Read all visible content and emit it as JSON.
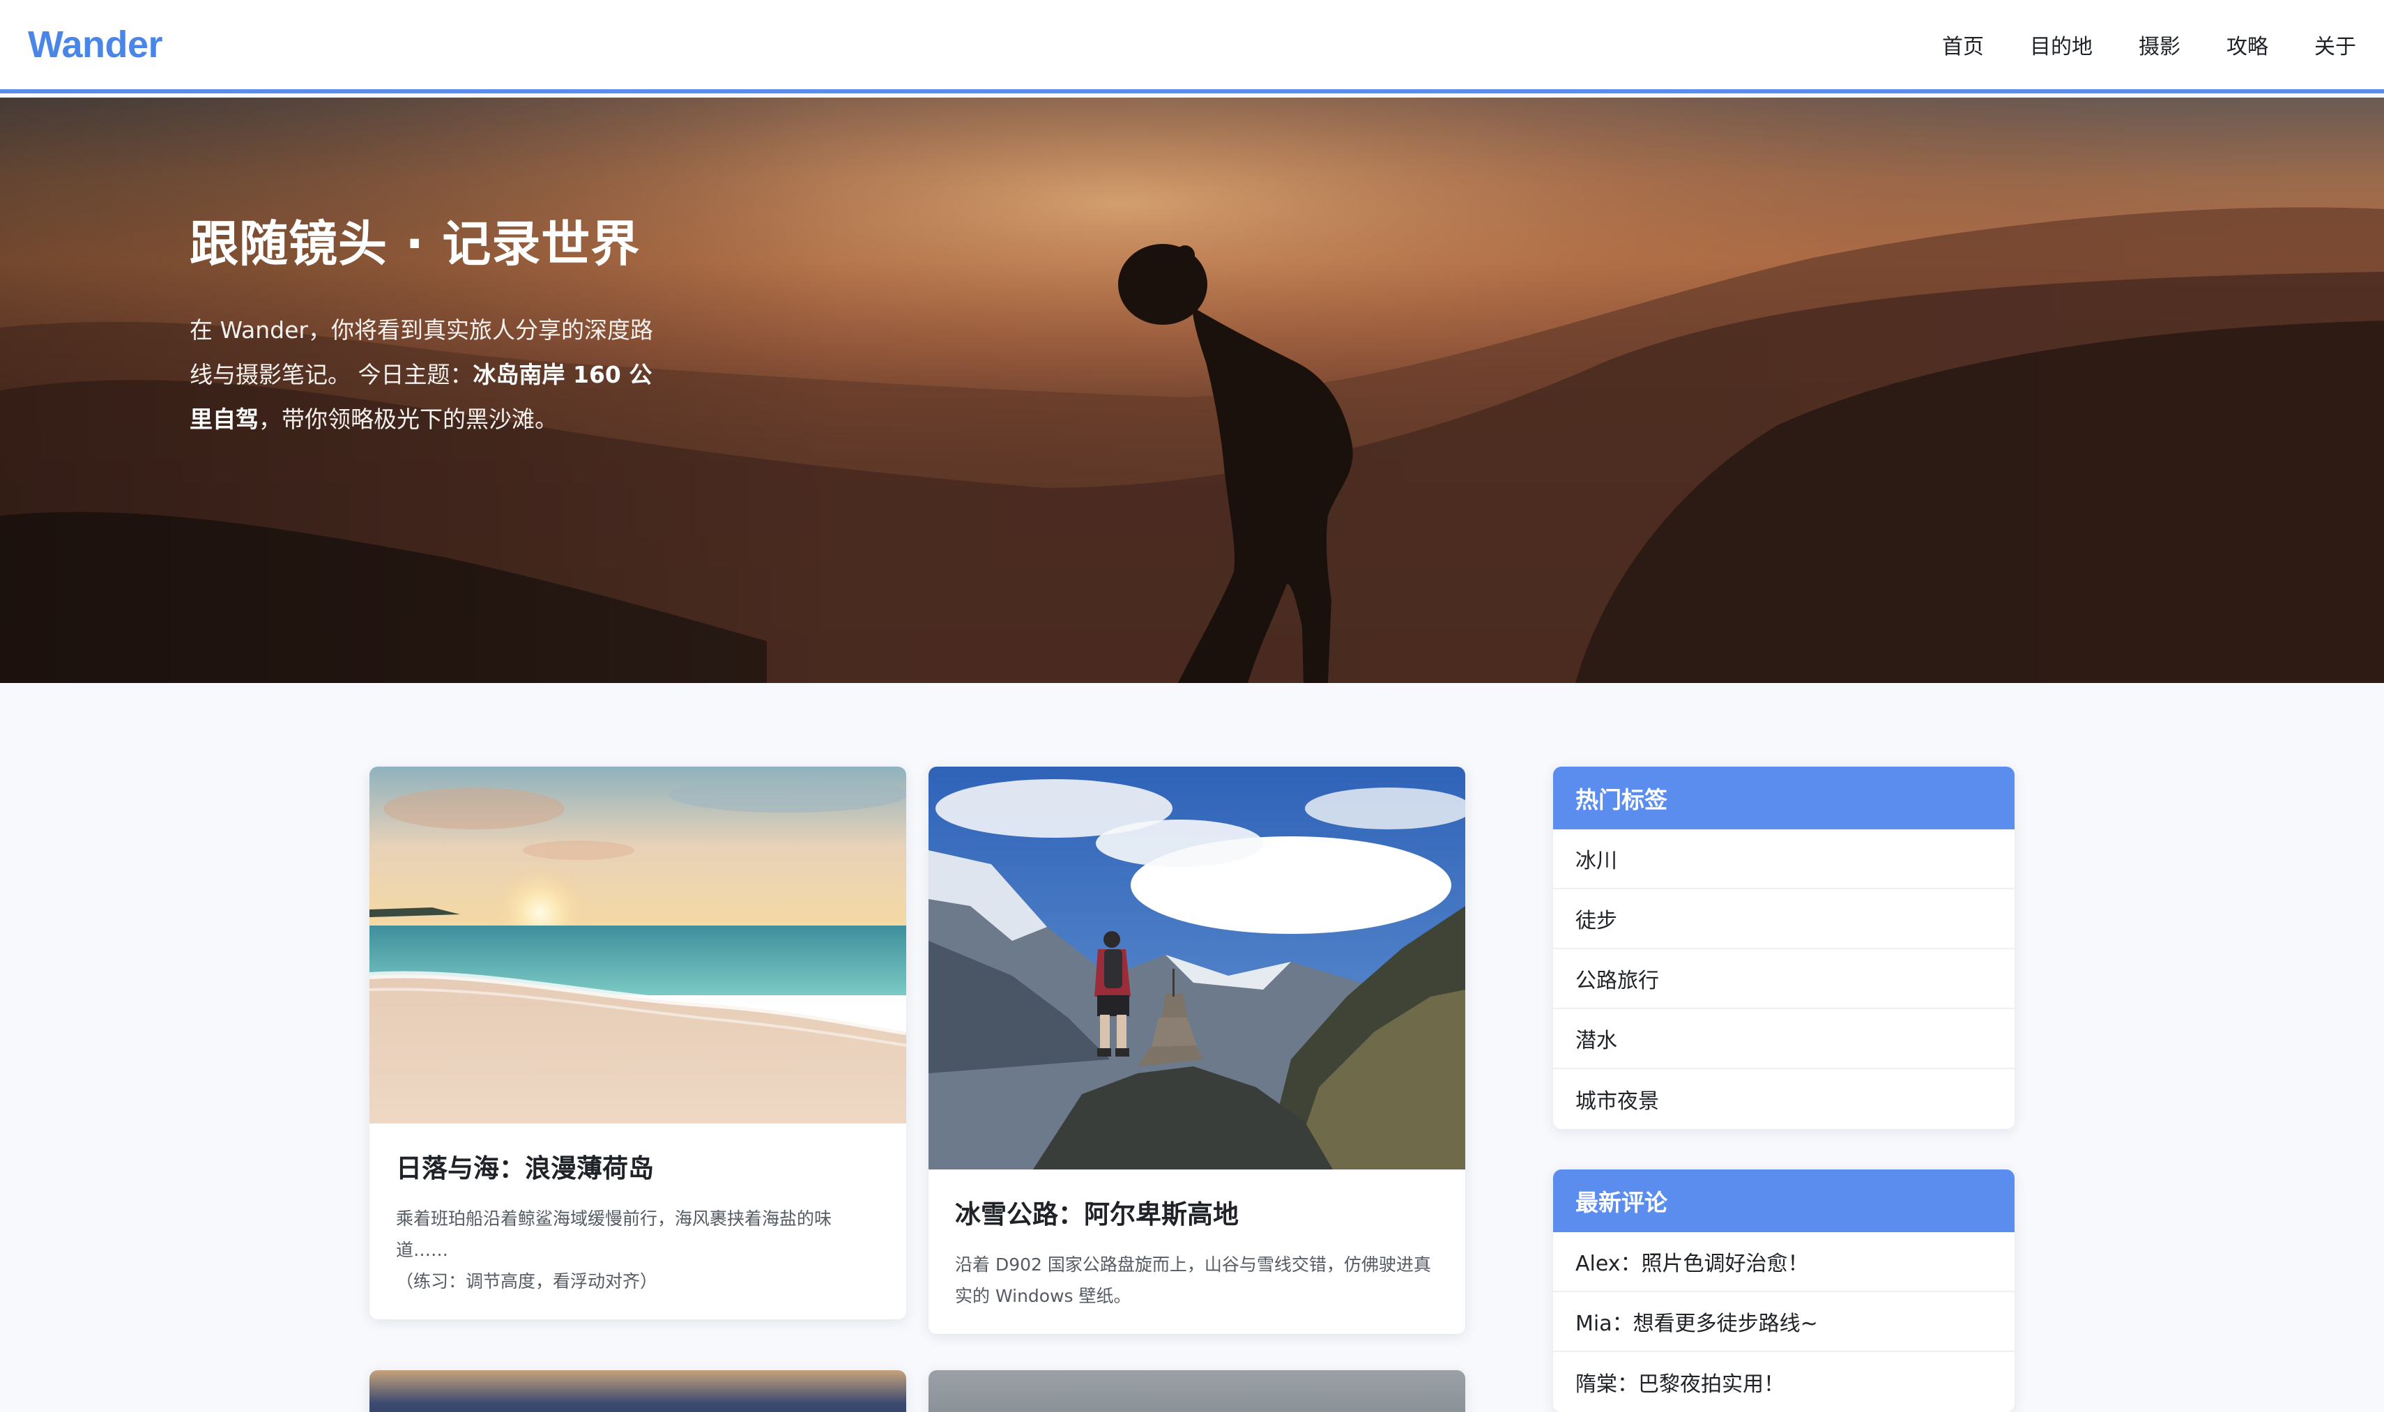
{
  "brand": {
    "name": "Wander",
    "accent": "#4a86e8"
  },
  "nav": {
    "items": [
      {
        "label": "首页"
      },
      {
        "label": "目的地"
      },
      {
        "label": "摄影"
      },
      {
        "label": "攻略"
      },
      {
        "label": "关于"
      }
    ]
  },
  "hero": {
    "title": "跟随镜头 · 记录世界",
    "desc_prefix": "在 Wander，你将看到真实旅人分享的深度路线与摄影笔记。 今日主题：",
    "desc_highlight": "冰岛南岸 160 公里自驾",
    "desc_suffix": "，带你领略极光下的黑沙滩。"
  },
  "cards": [
    {
      "title": "日落与海：浪漫薄荷岛",
      "text": "乘着班珀船沿着鲸鲨海域缓慢前行，海风裹挟着海盐的味道……",
      "note": "（练习：调节高度，看浮动对齐）"
    },
    {
      "title": "冰雪公路：阿尔卑斯高地",
      "text": "沿着 D902 国家公路盘旋而上，山谷与雪线交错，仿佛驶进真实的 Windows 壁纸。"
    }
  ],
  "sidebar": {
    "tags": {
      "heading": "热门标签",
      "items": [
        "冰川",
        "徒步",
        "公路旅行",
        "潜水",
        "城市夜景"
      ]
    },
    "comments": {
      "heading": "最新评论",
      "items": [
        "Alex：照片色调好治愈！",
        "Mia：想看更多徒步路线~",
        "隋棠：巴黎夜拍实用！"
      ]
    }
  }
}
